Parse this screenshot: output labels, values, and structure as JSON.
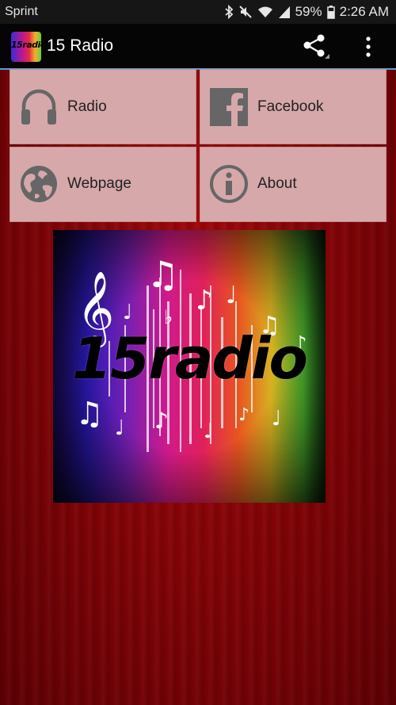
{
  "status_bar": {
    "carrier": "Sprint",
    "battery": "59%",
    "time": "2:26 AM",
    "icons": [
      "bluetooth-icon",
      "mute-icon",
      "wifi-icon",
      "signal-icon",
      "battery-icon"
    ]
  },
  "app_bar": {
    "logo_text": "15radio",
    "title": "15 Radio",
    "actions": [
      "share-icon",
      "overflow-menu-icon"
    ],
    "accent_color": "#4aa6d8"
  },
  "menu": {
    "items": [
      {
        "label": "Radio",
        "icon": "headphones-icon"
      },
      {
        "label": "Facebook",
        "icon": "facebook-icon"
      },
      {
        "label": "Webpage",
        "icon": "globe-icon"
      },
      {
        "label": "About",
        "icon": "info-icon"
      }
    ],
    "tile_color": "#d6a8aa"
  },
  "banner": {
    "wordmark": "15radio"
  },
  "colors": {
    "background": "#7d0306",
    "status_bar": "#161616",
    "app_bar": "#050505"
  }
}
